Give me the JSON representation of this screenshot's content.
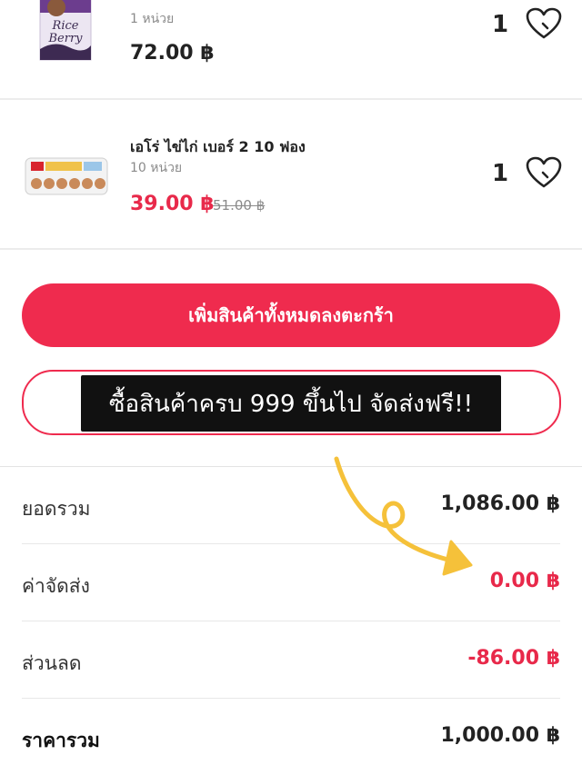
{
  "items": [
    {
      "name": "",
      "unit": "1 หน่วย",
      "price": "72.00 ฿",
      "old_price": "",
      "qty": "1",
      "thumb_text": [
        "Rice",
        "Berry"
      ]
    },
    {
      "name": "เอโร่ ไข่ไก่ เบอร์ 2 10 ฟอง",
      "unit": "10 หน่วย",
      "price": "39.00 ฿",
      "old_price": "51.00 ฿",
      "qty": "1"
    }
  ],
  "actions": {
    "add_all_to_cart": "เพิ่มสินค้าทั้งหมดลงตะกร้า",
    "free_shipping_banner": "ซื้อสินค้าครบ 999 ขึ้นไป จัดส่งฟรี!!"
  },
  "summary": {
    "subtotal_label": "ยอดรวม",
    "subtotal_value": "1,086.00 ฿",
    "shipping_label": "ค่าจัดส่ง",
    "shipping_value": "0.00 ฿",
    "discount_label": "ส่วนลด",
    "discount_value": "-86.00 ฿",
    "total_label": "ราคารวม",
    "total_value": "1,000.00 ฿"
  },
  "colors": {
    "accent": "#ef2b4e",
    "sale_price": "#e8294a",
    "annotation_arrow": "#f5c13a"
  },
  "icons": [
    "favorite-heart-icon",
    "annotation-arrow"
  ]
}
